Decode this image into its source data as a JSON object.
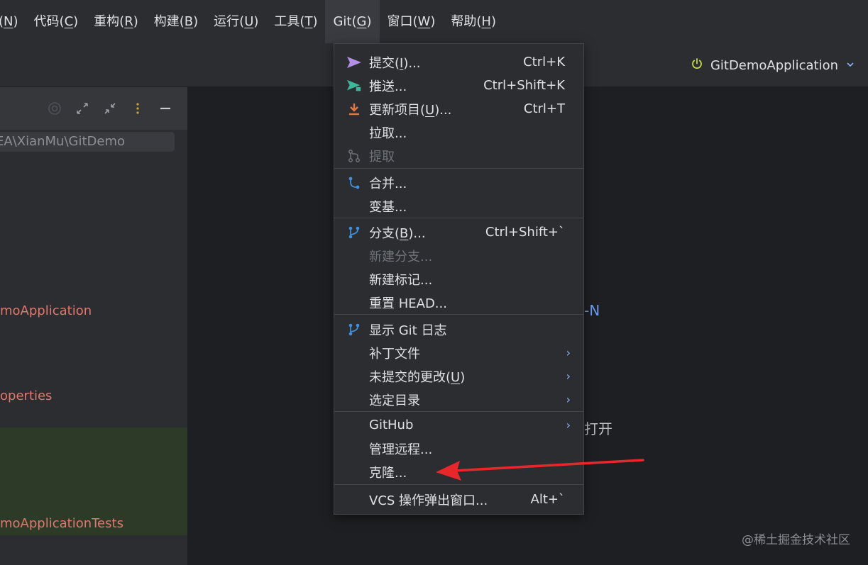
{
  "menubar": {
    "items": [
      {
        "text": "(",
        "mnemonic": "N",
        "close": ")"
      },
      {
        "text": "代码(",
        "mnemonic": "C",
        "close": ")"
      },
      {
        "text": "重构(",
        "mnemonic": "R",
        "close": ")"
      },
      {
        "text": "构建(",
        "mnemonic": "B",
        "close": ")"
      },
      {
        "text": "运行(",
        "mnemonic": "U",
        "close": ")"
      },
      {
        "text": "工具(",
        "mnemonic": "T",
        "close": ")"
      },
      {
        "text": "Git(",
        "mnemonic": "G",
        "close": ")"
      },
      {
        "text": "窗口(",
        "mnemonic": "W",
        "close": ")"
      },
      {
        "text": "帮助(",
        "mnemonic": "H",
        "close": ")"
      }
    ]
  },
  "toolbar": {
    "run_config": "GitDemoApplication"
  },
  "project": {
    "path": "EA\\XianMu\\GitDemo",
    "items": [
      "moApplication",
      "operties",
      "moApplicationTests"
    ]
  },
  "center": {
    "shortcut_fragment": "-N",
    "open_fragment": "打开"
  },
  "git_menu": {
    "commit": {
      "label": "提交(",
      "mnemonic": "I",
      "suffix": ")...",
      "shortcut": "Ctrl+K",
      "icon": "commit-arrow-icon"
    },
    "push": {
      "label": "推送...",
      "shortcut": "Ctrl+Shift+K",
      "icon": "push-arrow-icon"
    },
    "update": {
      "label": "更新项目(",
      "mnemonic": "U",
      "suffix": ")...",
      "shortcut": "Ctrl+T",
      "icon": "update-download-icon"
    },
    "pull": {
      "label": "拉取..."
    },
    "fetch": {
      "label": "提取",
      "icon": "fetch-icon"
    },
    "merge": {
      "label": "合并...",
      "icon": "merge-icon"
    },
    "rebase": {
      "label": "变基..."
    },
    "branches": {
      "label": "分支(",
      "mnemonic": "B",
      "suffix": ")...",
      "shortcut": "Ctrl+Shift+`",
      "icon": "branch-icon"
    },
    "new_branch": {
      "label": "新建分支..."
    },
    "new_tag": {
      "label": "新建标记..."
    },
    "reset_head": {
      "label": "重置 HEAD..."
    },
    "show_log": {
      "label": "显示 Git 日志",
      "icon": "git-log-icon"
    },
    "patch": {
      "label": "补丁文件"
    },
    "uncommitted": {
      "label": "未提交的更改(",
      "mnemonic": "U",
      "suffix": ")"
    },
    "current_dir": {
      "label": "选定目录"
    },
    "github": {
      "label": "GitHub"
    },
    "manage_remotes": {
      "label": "管理远程..."
    },
    "clone": {
      "label": "克隆..."
    },
    "vcs_popup": {
      "label": "VCS 操作弹出窗口...",
      "shortcut": "Alt+`"
    }
  },
  "watermark": "@稀土掘金技术社区",
  "colors": {
    "accent_red_arrow": "#e8272b",
    "tree_red": "#e0786b",
    "link_blue": "#6c9bef",
    "icon_blue": "#3d8fe0",
    "commit_purple": "#b48ee8",
    "push_teal": "#3fb59a",
    "update_orange": "#e07a45",
    "run_green": "#c7d94a"
  }
}
